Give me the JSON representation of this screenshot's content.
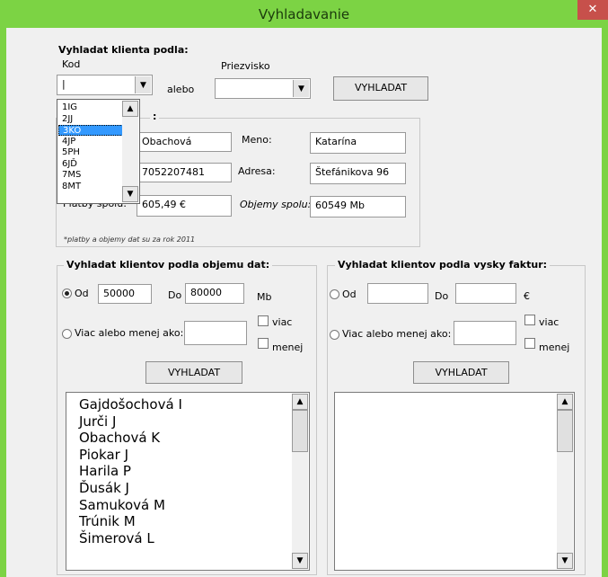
{
  "window": {
    "title": "Vyhladavanie",
    "close_glyph": "✕"
  },
  "client_search": {
    "heading": "Vyhladat klienta podla:",
    "kod_label": "Kod",
    "kod_value": "|",
    "alebo_label": "alebo",
    "priezvisko_label": "Priezvisko",
    "priezvisko_value": "",
    "search_button": "VYHLADAT",
    "dropdown_options": [
      "1IG",
      "2JJ",
      "3KO",
      "4JP",
      "5PH",
      "6JĎ",
      "7MS",
      "8MT"
    ],
    "dropdown_selected": "3KO"
  },
  "client_details": {
    "group_fragment": ":",
    "priezvisko_value": "Obachová",
    "meno_label": "Meno:",
    "meno_value": "Katarína",
    "cislo_value": "7052207481",
    "adresa_label": "Adresa:",
    "adresa_value": "Štefánikova 96",
    "platby_label": "Platby spolu:",
    "platby_value": "605,49 €",
    "objemy_label": "Objemy spolu:",
    "objemy_value": "60549 Mb",
    "note": "*platby a objemy dat su za rok 2011"
  },
  "data_volume": {
    "heading": "Vyhladat klientov podla objemu dat:",
    "od_label": "Od",
    "od_value": "50000",
    "do_label": "Do",
    "do_value": "80000",
    "unit": "Mb",
    "viac_menej_label": "Viac alebo menej ako:",
    "viac_menej_value": "",
    "viac_label": "viac",
    "menej_label": "menej",
    "search_button": "VYHLADAT",
    "results": [
      "Gajdošochová I",
      "Jurči J",
      "Obachová K",
      "Piokar J",
      "Harila P",
      "Ďusák J",
      "Samuková M",
      "Trúnik M",
      "Šimerová L"
    ]
  },
  "invoice": {
    "heading": "Vyhladat klientov podla vysky faktur:",
    "od_label": "Od",
    "od_value": "",
    "do_label": "Do",
    "do_value": "",
    "unit": "€",
    "viac_menej_label": "Viac alebo menej ako:",
    "viac_menej_value": "",
    "viac_label": "viac",
    "menej_label": "menej",
    "search_button": "VYHLADAT",
    "results": []
  },
  "icons": {
    "dropdown_arrow": "▼",
    "scroll_up": "▲",
    "scroll_down": "▼"
  }
}
